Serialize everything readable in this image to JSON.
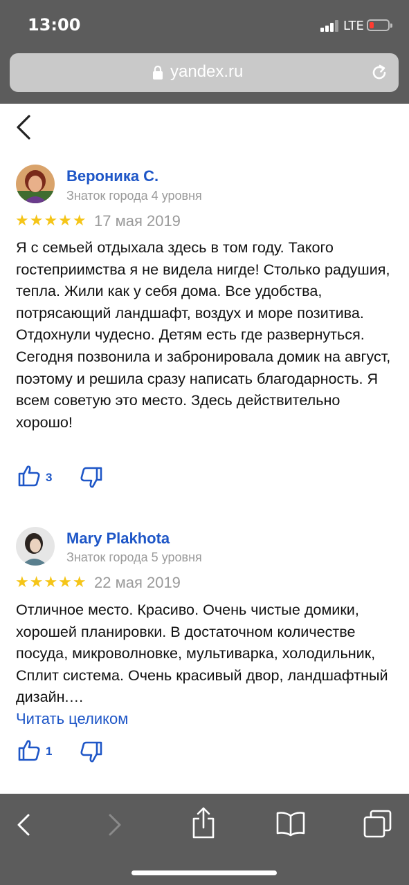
{
  "status": {
    "time": "13:00",
    "network": "LTE"
  },
  "browser": {
    "url": "yandex.ru"
  },
  "reviews": [
    {
      "author": "Вероника С.",
      "level": "Знаток города 4 уровня",
      "stars": "★★★★★",
      "date": "17 мая 2019",
      "text": "Я с семьей отдыхала здесь в том году. Такого гостеприимства я не видела нигде! Столько радушия, тепла. Жили как у себя дома. Все удобства, потрясающий ландшафт, воздух и море позитива. Отдохнули чудесно. Детям есть где развернуться. Сегодня позвонила и забронировала домик на август, поэтому и решила сразу написать благодарность. Я всем советую это место. Здесь действительно хорошо!",
      "likes": "3"
    },
    {
      "author": "Mary Plakhota",
      "level": "Знаток города 5 уровня",
      "stars": "★★★★★",
      "date": "22 мая 2019",
      "text": "Отличное место. Красиво. Очень чистые домики, хорошей планировки. В достаточном количестве посуда, микроволновке, мультиварка, холодильник, Сплит система. Очень красивый двор, ландшафтный дизайн.…",
      "read_more": "Читать целиком",
      "likes": "1"
    }
  ],
  "colors": {
    "link": "#1e56c7",
    "star": "#f5c518",
    "chrome": "#5c5c5c"
  }
}
